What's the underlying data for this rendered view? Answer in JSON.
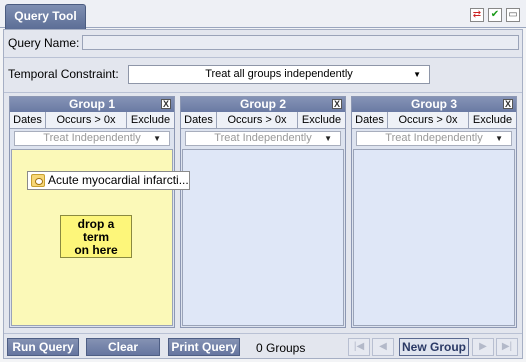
{
  "tab": {
    "label": "Query Tool"
  },
  "toolbar_icons": [
    "swap-icon",
    "check-icon",
    "window-icon"
  ],
  "query_name": {
    "label": "Query Name:",
    "value": ""
  },
  "temporal": {
    "label": "Temporal Constraint:",
    "value": "Treat all groups independently"
  },
  "groups": [
    {
      "title": "Group 1",
      "close": "X",
      "dates": "Dates",
      "occurs": "Occurs > 0x",
      "exclude": "Exclude",
      "timing": "Treat Independently",
      "concept": "Acute myocardial infarcti...",
      "drop_lines": [
        "drop a",
        "term",
        "on here"
      ]
    },
    {
      "title": "Group 2",
      "close": "X",
      "dates": "Dates",
      "occurs": "Occurs > 0x",
      "exclude": "Exclude",
      "timing": "Treat Independently"
    },
    {
      "title": "Group 3",
      "close": "X",
      "dates": "Dates",
      "occurs": "Occurs > 0x",
      "exclude": "Exclude",
      "timing": "Treat Independently"
    }
  ],
  "bottom": {
    "run": "Run Query",
    "clear": "Clear",
    "print": "Print Query",
    "count": "0 Groups",
    "new_group": "New Group",
    "nav": {
      "first": "|◀",
      "prev": "◀",
      "next": "▶",
      "last": "▶|"
    }
  }
}
